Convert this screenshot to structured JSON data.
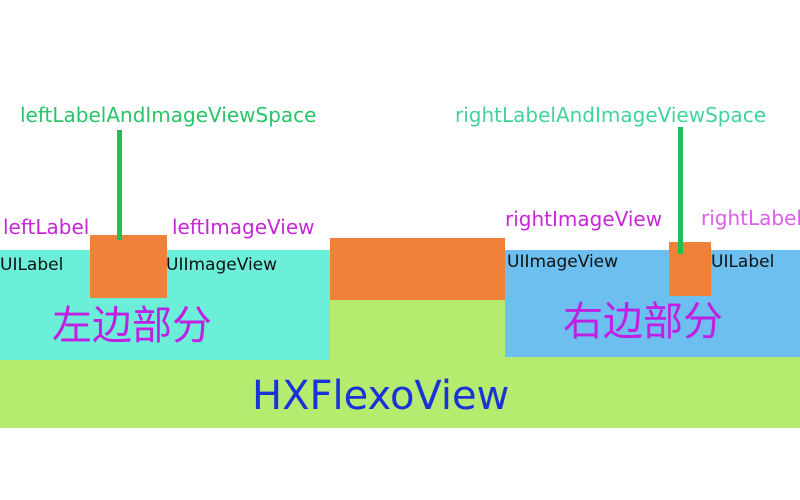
{
  "labels": {
    "left_space": "leftLabelAndImageViewSpace",
    "right_space": "rightLabelAndImageViewSpace",
    "left_label": "leftLabel",
    "left_image_view": "leftImageView",
    "right_image_view": "rightImageView",
    "right_label": "rightLabel",
    "uilabel_left": "UILabel",
    "uiimageview_left": "UIImageView",
    "uiimageview_right": "UIImageView",
    "uilabel_right": "UILabel",
    "left_section": "左边部分",
    "right_section": "右边部分",
    "flexo_view": "HXFlexoView"
  },
  "colors": {
    "flexo_view": "#b5eb6f",
    "left_part": "#6cefd9",
    "right_part": "#6cbfee",
    "space_blocks": "#ef8138",
    "pointer": "#1fbf55",
    "annotation_green": "#2ac468",
    "annotation_magenta": "#c628d6",
    "section_text": "#c020e3",
    "title_text": "#1a33d8"
  }
}
